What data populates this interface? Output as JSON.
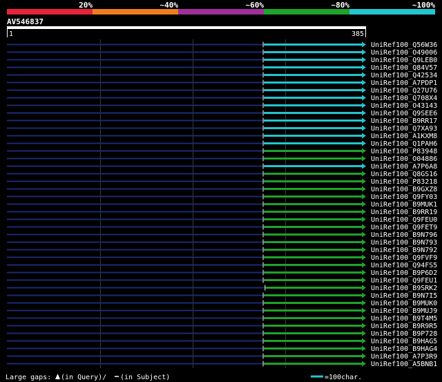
{
  "colors": {
    "background": "#000000",
    "band_red": "#e8233a",
    "band_orange": "#ef7d1e",
    "band_purple": "#a02f9a",
    "band_green": "#1fa32a",
    "band_cyan": "#22c5d0",
    "hit_cyan": "#22c5d0",
    "hit_green": "#1fa32a",
    "gap_navy": "#1c2a72",
    "grid": "#3a3a3a",
    "text": "#ffffff"
  },
  "identity_legend": [
    "20%",
    "~40%",
    "~60%",
    "~80%",
    "~100%"
  ],
  "query": {
    "id": "AV546837",
    "start": "1",
    "end": "385",
    "length": 385
  },
  "hits": [
    {
      "name": "UniRef100_Q56W36",
      "class": "cyan",
      "qstart": 275
    },
    {
      "name": "UniRef100_O49006",
      "class": "cyan",
      "qstart": 275
    },
    {
      "name": "UniRef100_Q9LEB0",
      "class": "cyan",
      "qstart": 275
    },
    {
      "name": "UniRef100_Q84V57",
      "class": "cyan",
      "qstart": 275
    },
    {
      "name": "UniRef100_Q42534",
      "class": "cyan",
      "qstart": 275
    },
    {
      "name": "UniRef100_A7PDP1",
      "class": "cyan",
      "qstart": 275
    },
    {
      "name": "UniRef100_Q27U76",
      "class": "cyan",
      "qstart": 275
    },
    {
      "name": "UniRef100_Q708X4",
      "class": "cyan",
      "qstart": 275
    },
    {
      "name": "UniRef100_O43143",
      "class": "cyan",
      "qstart": 275
    },
    {
      "name": "UniRef100_Q9SEE6",
      "class": "cyan",
      "qstart": 275
    },
    {
      "name": "UniRef100_B9RR17",
      "class": "cyan",
      "qstart": 275
    },
    {
      "name": "UniRef100_Q7XA93",
      "class": "cyan",
      "qstart": 275
    },
    {
      "name": "UniRef100_A1KXM8",
      "class": "cyan",
      "qstart": 275
    },
    {
      "name": "UniRef100_Q1PAH6",
      "class": "cyan",
      "qstart": 275
    },
    {
      "name": "UniRef100_P83948",
      "class": "green",
      "qstart": 275
    },
    {
      "name": "UniRef100_O04886",
      "class": "green",
      "qstart": 275
    },
    {
      "name": "UniRef100_A7P6A8",
      "class": "cyan",
      "qstart": 275
    },
    {
      "name": "UniRef100_Q8GS16",
      "class": "green",
      "qstart": 275
    },
    {
      "name": "UniRef100_P83218",
      "class": "green",
      "qstart": 275
    },
    {
      "name": "UniRef100_B9GXZ8",
      "class": "green",
      "qstart": 275
    },
    {
      "name": "UniRef100_Q9FY03",
      "class": "green",
      "qstart": 275
    },
    {
      "name": "UniRef100_B9MUK1",
      "class": "green",
      "qstart": 275
    },
    {
      "name": "UniRef100_B9RR19",
      "class": "green",
      "qstart": 275
    },
    {
      "name": "UniRef100_Q9FEU0",
      "class": "green",
      "qstart": 275
    },
    {
      "name": "UniRef100_Q9FET9",
      "class": "green",
      "qstart": 275
    },
    {
      "name": "UniRef100_B9N796",
      "class": "green",
      "qstart": 275
    },
    {
      "name": "UniRef100_B9N793",
      "class": "green",
      "qstart": 275
    },
    {
      "name": "UniRef100_B9N792",
      "class": "green",
      "qstart": 275
    },
    {
      "name": "UniRef100_Q9FVF9",
      "class": "green",
      "qstart": 275
    },
    {
      "name": "UniRef100_Q94FS5",
      "class": "green",
      "qstart": 275
    },
    {
      "name": "UniRef100_B9P6D2",
      "class": "green",
      "qstart": 275
    },
    {
      "name": "UniRef100_Q9FEU1",
      "class": "green",
      "qstart": 275
    },
    {
      "name": "UniRef100_B9SRK2",
      "class": "green",
      "qstart": 277
    },
    {
      "name": "UniRef100_B9N7I5",
      "class": "green",
      "qstart": 275
    },
    {
      "name": "UniRef100_B9MUK0",
      "class": "green",
      "qstart": 275
    },
    {
      "name": "UniRef100_B9MUJ9",
      "class": "green",
      "qstart": 275
    },
    {
      "name": "UniRef100_B9T4M5",
      "class": "green",
      "qstart": 275
    },
    {
      "name": "UniRef100_B9R9R5",
      "class": "green",
      "qstart": 275
    },
    {
      "name": "UniRef100_B9P728",
      "class": "green",
      "qstart": 275
    },
    {
      "name": "UniRef100_B9HAG5",
      "class": "green",
      "qstart": 275
    },
    {
      "name": "UniRef100_B9HAG4",
      "class": "green",
      "qstart": 275
    },
    {
      "name": "UniRef100_A7P3R9",
      "class": "green",
      "qstart": 275
    },
    {
      "name": "UniRef100_A5BNB1",
      "class": "green",
      "qstart": 275
    }
  ],
  "footer": {
    "large_gaps_label": "Large gaps:",
    "in_query": "(in Query)/",
    "in_subject": "(in Subject)",
    "scale_label": "=100char."
  }
}
